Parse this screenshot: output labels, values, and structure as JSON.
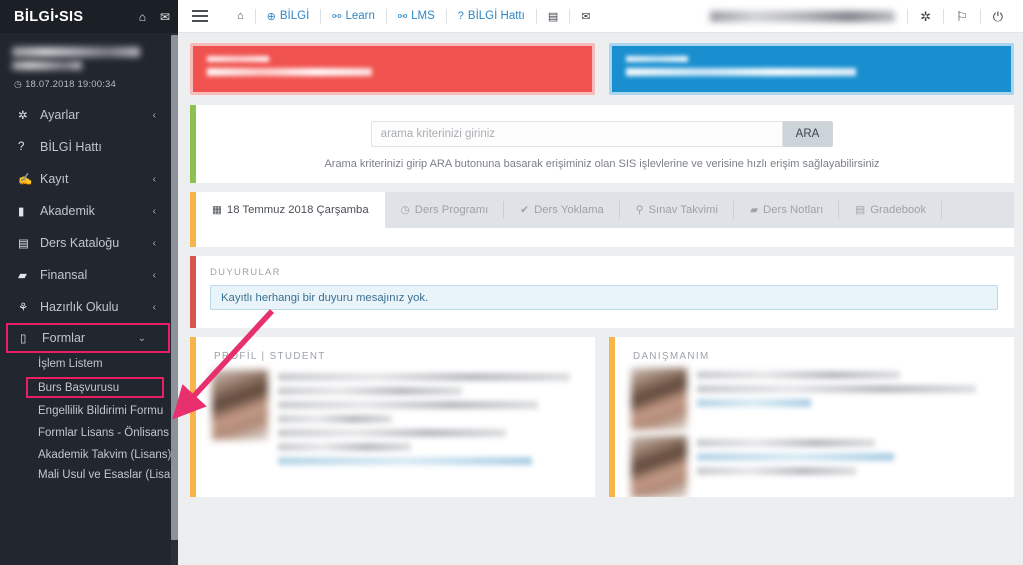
{
  "brand": {
    "name_left": "BİLGİ",
    "dot": "•",
    "name_right": "SIS",
    "home_icon": "⌂",
    "mail_icon": "✉"
  },
  "sidebar": {
    "timestamp": "18.07.2018 19:00:34",
    "clock_icon": "◷",
    "items": [
      {
        "label": "Ayarlar",
        "icon": "✲",
        "chevron": "‹",
        "name": "ayarlar"
      },
      {
        "label": "BİLGİ Hattı",
        "icon": "?",
        "chevron": "",
        "name": "bilgi-hatti"
      },
      {
        "label": "Kayıt",
        "icon": "✍",
        "chevron": "‹",
        "name": "kayit"
      },
      {
        "label": "Akademik",
        "icon": "▮",
        "chevron": "‹",
        "name": "akademik"
      },
      {
        "label": "Ders Kataloğu",
        "icon": "▤",
        "chevron": "‹",
        "name": "ders-katalogu"
      },
      {
        "label": "Finansal",
        "icon": "▰",
        "chevron": "‹",
        "name": "finansal"
      },
      {
        "label": "Hazırlık Okulu",
        "icon": "⚘",
        "chevron": "‹",
        "name": "hazirlik-okulu"
      },
      {
        "label": "Formlar",
        "icon": "▯",
        "chevron": "⌄",
        "name": "formlar",
        "highlight": true
      }
    ],
    "subitems": [
      {
        "label": "İşlem Listem",
        "name": "islem-listem"
      },
      {
        "label": "Burs Başvurusu",
        "name": "burs-basvurusu",
        "highlight": true
      },
      {
        "label": "Engellilik Bildirimi Formu",
        "name": "engellilik-bildirimi-formu"
      },
      {
        "label": "Formlar Lisans - Önlisans",
        "name": "formlar-lisans-onlisans"
      },
      {
        "label": "Akademik Takvim (Lisans)",
        "name": "akademik-takvim-lisans"
      },
      {
        "label": "Mali Usul ve Esaslar (Lisans ve Önlisans)",
        "name": "mali-usul-ve-esaslar"
      }
    ]
  },
  "topbar": {
    "menu_icon": "hamburger",
    "items": [
      {
        "label": "",
        "icon": "⌂",
        "name": "home",
        "style": "dark"
      },
      {
        "label": "BİLGİ",
        "icon": "⊕",
        "name": "bilgi",
        "style": "link"
      },
      {
        "label": "Learn",
        "icon": "⚯",
        "name": "learn",
        "style": "link"
      },
      {
        "label": "LMS",
        "icon": "⚯",
        "name": "lms",
        "style": "link"
      },
      {
        "label": "BİLGİ Hattı",
        "icon": "?",
        "name": "bilgi-hatti",
        "style": "link"
      },
      {
        "label": "",
        "icon": "▤",
        "name": "shuttle",
        "style": "dark"
      },
      {
        "label": "",
        "icon": "✉",
        "name": "mail",
        "style": "dark"
      }
    ],
    "right_icons": [
      {
        "icon": "✲",
        "name": "settings-gear"
      },
      {
        "icon": "⚐",
        "name": "flag"
      },
      {
        "icon": "⏻",
        "name": "power-logout"
      }
    ]
  },
  "alerts": [
    {
      "color": "#f0534f",
      "name": "alert-red"
    },
    {
      "color": "#1a8fd0",
      "name": "alert-blue"
    }
  ],
  "search": {
    "placeholder": "arama kriterinizi giriniz",
    "value": "",
    "button_label": "ARA",
    "hint": "Arama kriterinizi girip ARA butonuna basarak erişiminiz olan SIS işlevlerine ve verisine hızlı erişim sağlayabilirsiniz",
    "accent_color": "#8cc152"
  },
  "tabs": {
    "accent_color": "#f6b44a",
    "items": [
      {
        "label": "18 Temmuz 2018 Çarşamba",
        "icon": "▦",
        "active": true,
        "name": "tab-date"
      },
      {
        "label": "Ders Programı",
        "icon": "◷",
        "active": false,
        "name": "tab-ders-programi"
      },
      {
        "label": "Ders Yoklama",
        "icon": "✔",
        "active": false,
        "name": "tab-ders-yoklama"
      },
      {
        "label": "Sınav Takvimi",
        "icon": "⚲",
        "active": false,
        "name": "tab-sinav-takvimi"
      },
      {
        "label": "Ders Notları",
        "icon": "▰",
        "active": false,
        "name": "tab-ders-notlari"
      },
      {
        "label": "Gradebook",
        "icon": "▤",
        "active": false,
        "name": "tab-gradebook"
      }
    ]
  },
  "duyurular": {
    "title": "DUYURULAR",
    "message": "Kayıtlı herhangi bir duyuru mesajınız yok.",
    "accent_color": "#d9534f"
  },
  "profil": {
    "title": "PROFİL | STUDENT",
    "accent_color": "#f6b44a"
  },
  "danismanim": {
    "title": "DANIŞMANIM",
    "accent_color": "#f6b44a"
  },
  "annotation": {
    "highlight_color": "#e91e63",
    "arrow": "pink-arrow-pointing-to-burs-basvurusu"
  }
}
